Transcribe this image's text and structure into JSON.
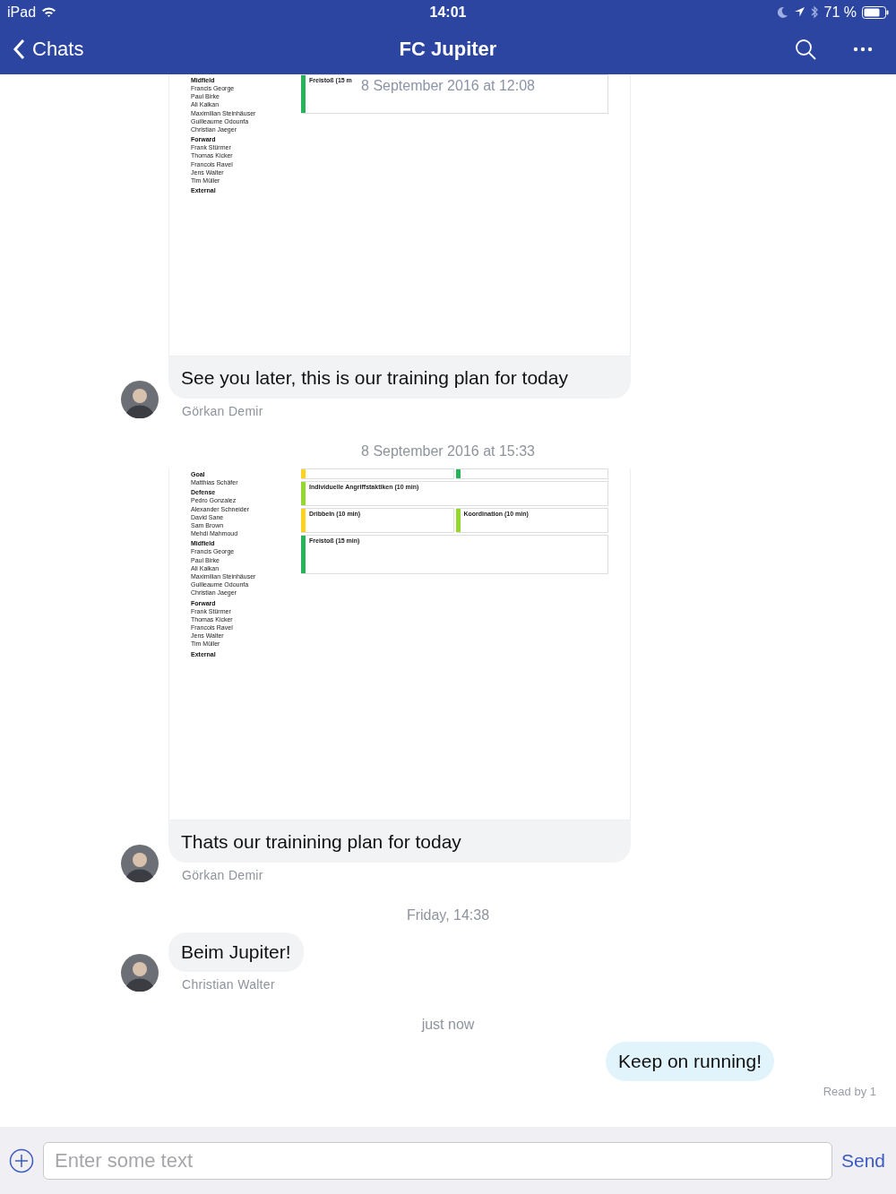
{
  "status_bar": {
    "device": "iPad",
    "time": "14:01",
    "battery": "71 %"
  },
  "nav": {
    "back": "Chats",
    "title": "FC Jupiter"
  },
  "sticky_date": "8 September 2016 at 12:08",
  "feed": [
    {
      "kind": "incoming",
      "sender": "Görkan Demir",
      "text": "See you later, this is our training plan for today",
      "document": {
        "roster": [
          {
            "title": "Midfield",
            "members": [
              "Francis George",
              "Paul Birke",
              "Ali Kalkan",
              "Maximilian Steinhäuser",
              "Guilleaume Odounfa",
              "Christian Jaeger"
            ]
          },
          {
            "title": "Forward",
            "members": [
              "Frank Stürmer",
              "Thomas Kicker",
              "Francois Ravel",
              "Jens Walter",
              "Tim Müller"
            ]
          },
          {
            "title": "External"
          }
        ],
        "plan": [
          [
            {
              "title": "Freistoß (15 m",
              "color": "#27b35a"
            }
          ]
        ]
      }
    },
    {
      "kind": "date",
      "text": "8 September 2016 at 15:33"
    },
    {
      "kind": "incoming",
      "sender": "Görkan Demir",
      "text": "Thats our trainining plan for today",
      "document": {
        "roster": [
          {
            "title": "Goal",
            "members": [
              "Matthias  Schäfer"
            ]
          },
          {
            "title": "Defense",
            "members": [
              "Pedro Gonzalez",
              "Alexander Schneider",
              "David Sane",
              "Sam Brown",
              "Mehdi Mahmoud"
            ]
          },
          {
            "title": "Midfield",
            "members": [
              "Francis George",
              "Paul Birke",
              "Ali Kalkan",
              "Maximilian Steinhäuser",
              "Guilleaume Odounfa",
              "Christian Jaeger"
            ]
          },
          {
            "title": "Forward",
            "members": [
              "Frank Stürmer",
              "Thomas Kicker",
              "Francois Ravel",
              "Jens Walter",
              "Tim Müller"
            ]
          },
          {
            "title": "External"
          }
        ],
        "plan": [
          [
            {
              "color": "#ffd21f"
            },
            {
              "color": "#27b35a"
            }
          ],
          [
            {
              "title": "Individuelle Angriffstaktiken (10 min)",
              "color": "#94d82d"
            }
          ],
          [
            {
              "title": "Dribbeln (10 min)",
              "color": "#ffd21f"
            },
            {
              "title": "Koordination (10 min)",
              "color": "#94d82d"
            }
          ],
          [
            {
              "title": "Freistoß (15 min)",
              "color": "#27b35a"
            }
          ]
        ]
      }
    },
    {
      "kind": "date",
      "text": "Friday, 14:38"
    },
    {
      "kind": "incoming",
      "sender": "Christian Walter",
      "text": "Beim Jupiter!"
    },
    {
      "kind": "date",
      "text": "just now"
    },
    {
      "kind": "outgoing",
      "text": "Keep on running!"
    },
    {
      "kind": "receipt",
      "text": "Read by 1"
    }
  ],
  "composer": {
    "placeholder": "Enter some text",
    "send": "Send"
  }
}
